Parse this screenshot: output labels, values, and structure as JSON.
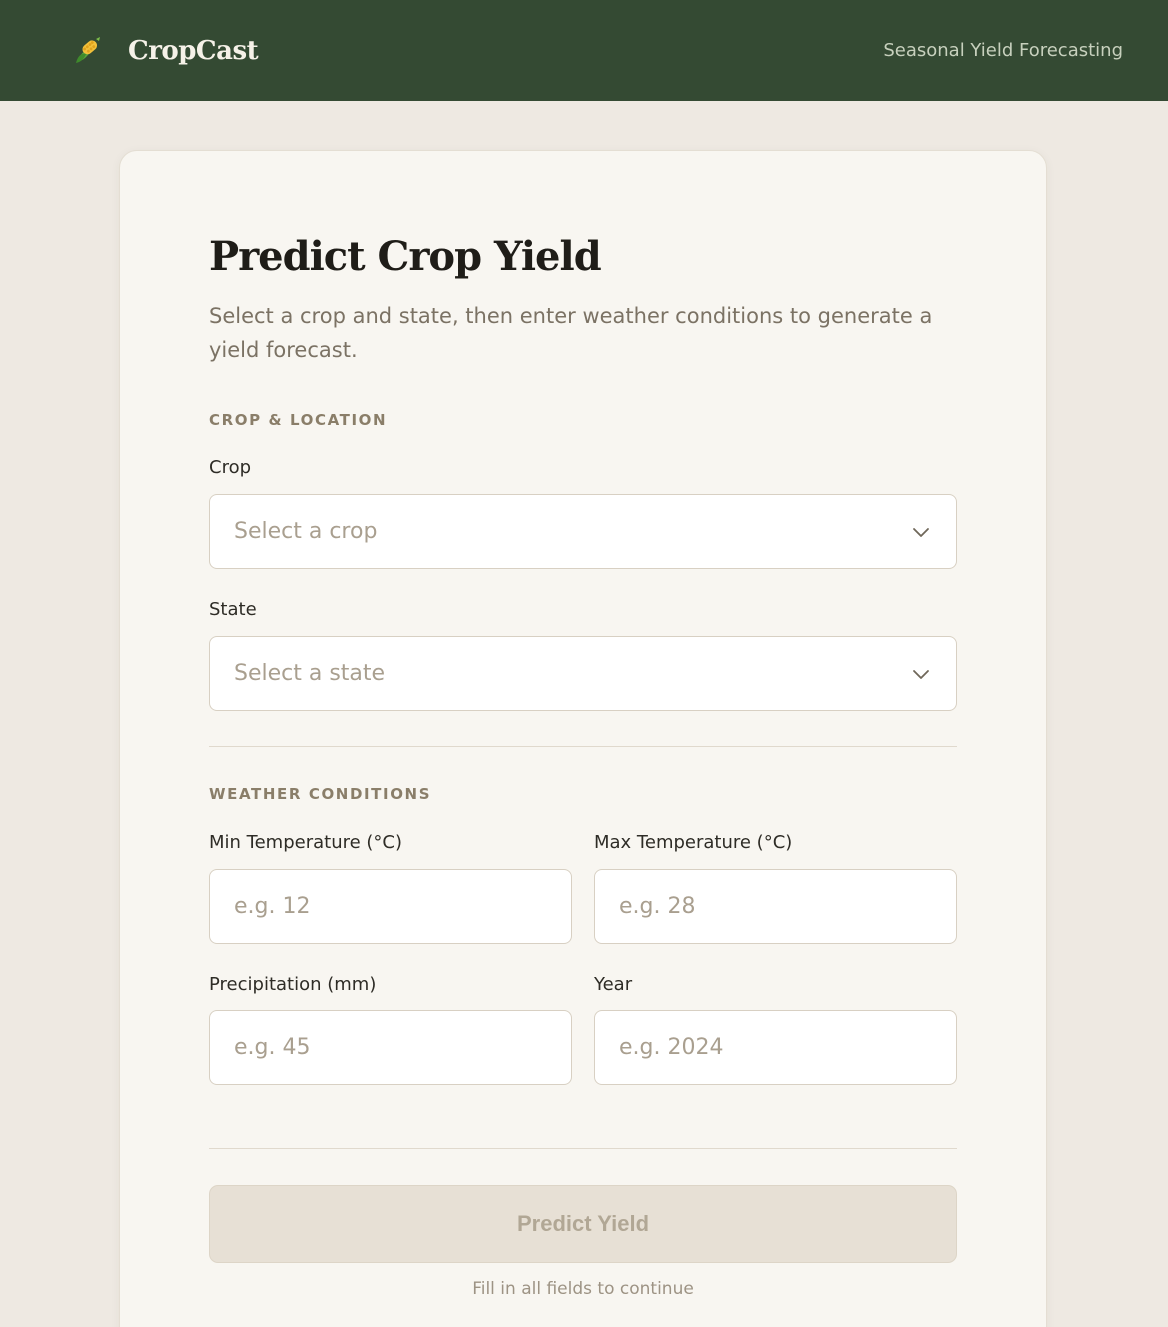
{
  "header": {
    "logo_icon": "corn-icon",
    "brand": "CropCast",
    "tagline": "Seasonal Yield Forecasting"
  },
  "form": {
    "title": "Predict Crop Yield",
    "subtitle": "Select a crop and state, then enter weather conditions to generate a yield forecast.",
    "section_location": "CROP & LOCATION",
    "crop_label": "Crop",
    "crop_placeholder": "Select a crop",
    "state_label": "State",
    "state_placeholder": "Select a state",
    "section_weather": "WEATHER CONDITIONS",
    "min_temp_label": "Min Temperature (°C)",
    "min_temp_placeholder": "e.g. 12",
    "max_temp_label": "Max Temperature (°C)",
    "max_temp_placeholder": "e.g. 28",
    "precip_label": "Precipitation (mm)",
    "precip_placeholder": "e.g. 45",
    "year_label": "Year",
    "year_placeholder": "e.g. 2024",
    "submit_label": "Predict Yield",
    "hint": "Fill in all fields to continue"
  },
  "colors": {
    "header_bg": "#344a33",
    "page_bg": "#eee9e2",
    "card_bg": "#f8f6f1",
    "disabled_button_bg": "#e7e0d5"
  }
}
